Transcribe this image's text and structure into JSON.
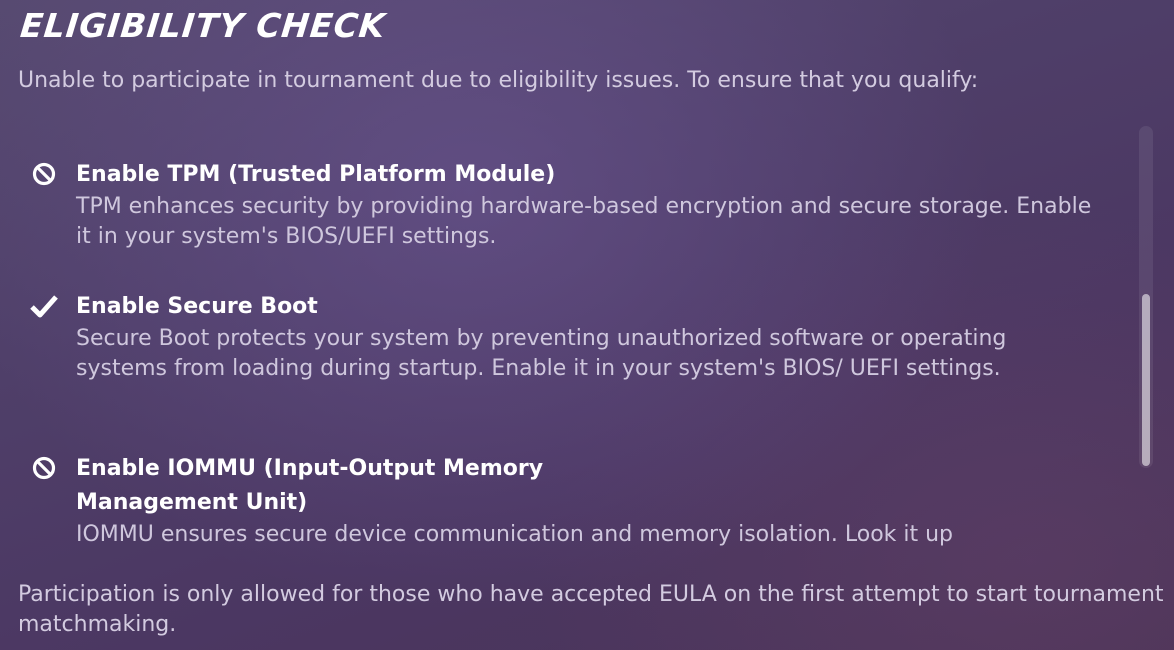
{
  "dialog": {
    "title": "ELIGIBILITY CHECK",
    "intro": "Unable to participate in tournament due to eligibility issues. To ensure that you qualify:",
    "requirements": [
      {
        "icon": "blocked-icon",
        "status": "not-met",
        "title": "Enable TPM (Trusted Platform Module)",
        "description": "TPM enhances security by providing hardware-based encryption and secure storage. Enable it in your system's BIOS/UEFI settings."
      },
      {
        "icon": "checkmark-icon",
        "status": "met",
        "title": "Enable Secure Boot",
        "description": "Secure Boot protects your system by preventing unauthorized software or operating systems from loading during startup. Enable it in your system's BIOS/ UEFI settings."
      },
      {
        "icon": "blocked-icon",
        "status": "not-met",
        "title": "Enable IOMMU (Input-Output Memory Management Unit)",
        "description": "IOMMU ensures secure device communication and memory isolation. Look it up"
      }
    ],
    "footer": "Participation is only allowed for those who have accepted EULA on the first attempt to start tournament matchmaking."
  },
  "colors": {
    "title": "#ffffff",
    "body_text": "#d3cbe0",
    "icon": "#ffffff",
    "background": "#4f3f69"
  }
}
